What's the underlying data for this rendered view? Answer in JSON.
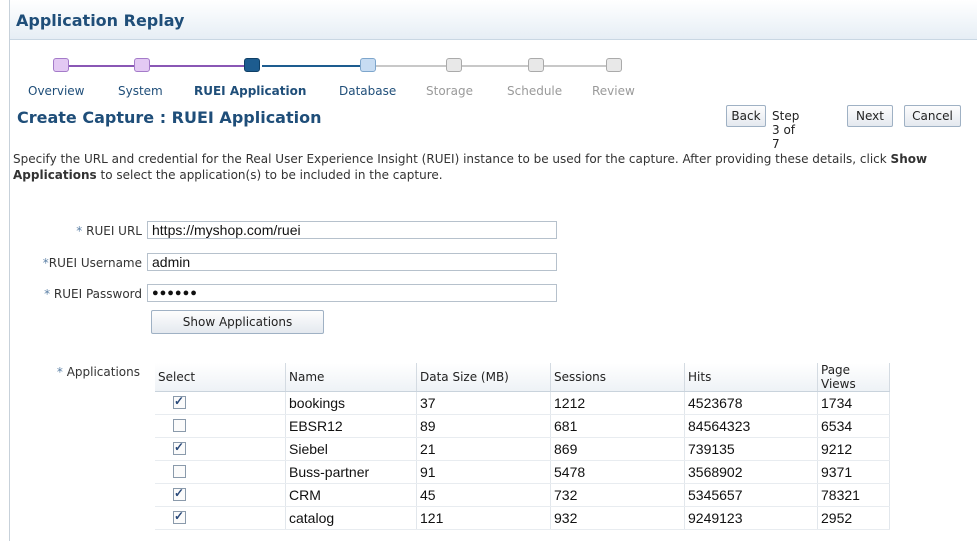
{
  "app": {
    "title": "Application Replay"
  },
  "train": {
    "steps": [
      {
        "label": "Overview",
        "state": "visited"
      },
      {
        "label": "System",
        "state": "visited"
      },
      {
        "label": "RUEI Application",
        "state": "current"
      },
      {
        "label": "Database",
        "state": "next"
      },
      {
        "label": "Storage",
        "state": "disabled"
      },
      {
        "label": "Schedule",
        "state": "disabled"
      },
      {
        "label": "Review",
        "state": "disabled"
      }
    ]
  },
  "page": {
    "heading": "Create Capture : RUEI Application"
  },
  "nav": {
    "back_label": "Back",
    "step_text": "Step 3 of 7",
    "next_label": "Next",
    "cancel_label": "Cancel"
  },
  "instructions": {
    "text_before": "Specify the URL and credential for the Real User Experience Insight (RUEI) instance to be used for the capture. After providing these details, click ",
    "bold": "Show Applications",
    "text_after": " to select the application(s) to be included in the capture."
  },
  "form": {
    "required_marker": "*",
    "url_label": "RUEI URL",
    "url_value": "https://myshop.com/ruei",
    "username_label": "RUEI Username",
    "username_value": "admin",
    "password_label": "RUEI Password",
    "password_value": "●●●●●●",
    "show_apps_label": "Show Applications",
    "applications_label": "Applications"
  },
  "table": {
    "columns": [
      "Select",
      "Name",
      "Data Size (MB)",
      "Sessions",
      "Hits",
      "Page Views"
    ],
    "rows": [
      {
        "selected": true,
        "name": "bookings",
        "size": "37",
        "sessions": "1212",
        "hits": "4523678",
        "views": "1734"
      },
      {
        "selected": false,
        "name": "EBSR12",
        "size": "89",
        "sessions": "681",
        "hits": "84564323",
        "views": "6534"
      },
      {
        "selected": true,
        "name": "Siebel",
        "size": "21",
        "sessions": "869",
        "hits": "739135",
        "views": "9212"
      },
      {
        "selected": false,
        "name": "Buss-partner",
        "size": "91",
        "sessions": "5478",
        "hits": "3568902",
        "views": "9371"
      },
      {
        "selected": true,
        "name": "CRM",
        "size": "45",
        "sessions": "732",
        "hits": "5345657",
        "views": "78321"
      },
      {
        "selected": true,
        "name": "catalog",
        "size": "121",
        "sessions": "932",
        "hits": "9249123",
        "views": "2952"
      }
    ]
  }
}
